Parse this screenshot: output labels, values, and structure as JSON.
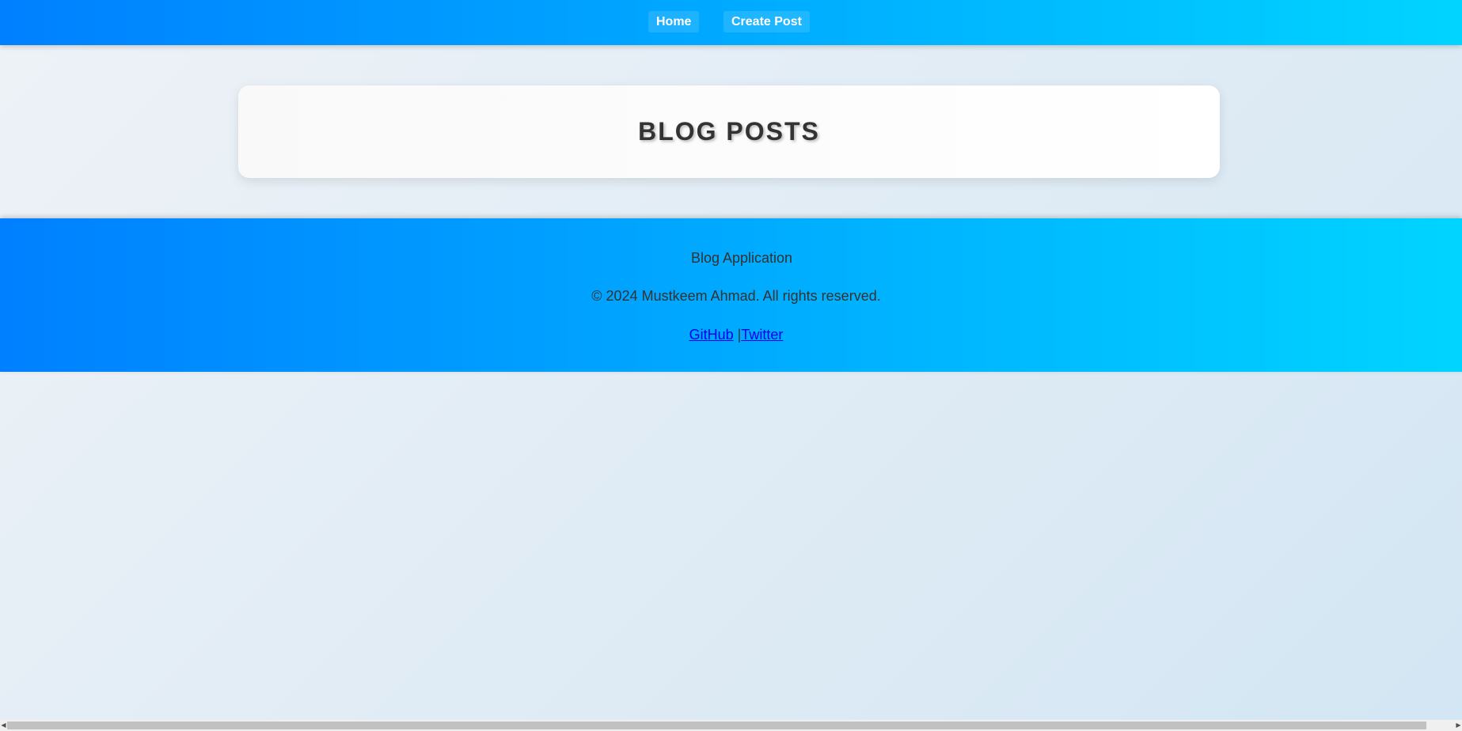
{
  "nav": {
    "home_label": "Home",
    "create_label": "Create Post"
  },
  "main": {
    "title": "BLOG POSTS"
  },
  "footer": {
    "app_name": "Blog Application",
    "copyright": "© 2024 Mustkeem Ahmad. All rights reserved.",
    "links": {
      "github_label": "GitHub",
      "separator": "|",
      "twitter_label": "Twitter"
    }
  },
  "colors": {
    "nav_gradient_start": "#0080ff",
    "nav_gradient_end": "#00d4ff",
    "link": "#0000ee",
    "title_text": "#333333"
  },
  "icons": {
    "scroll_left": "arrow-left-icon",
    "scroll_right": "arrow-right-icon"
  }
}
